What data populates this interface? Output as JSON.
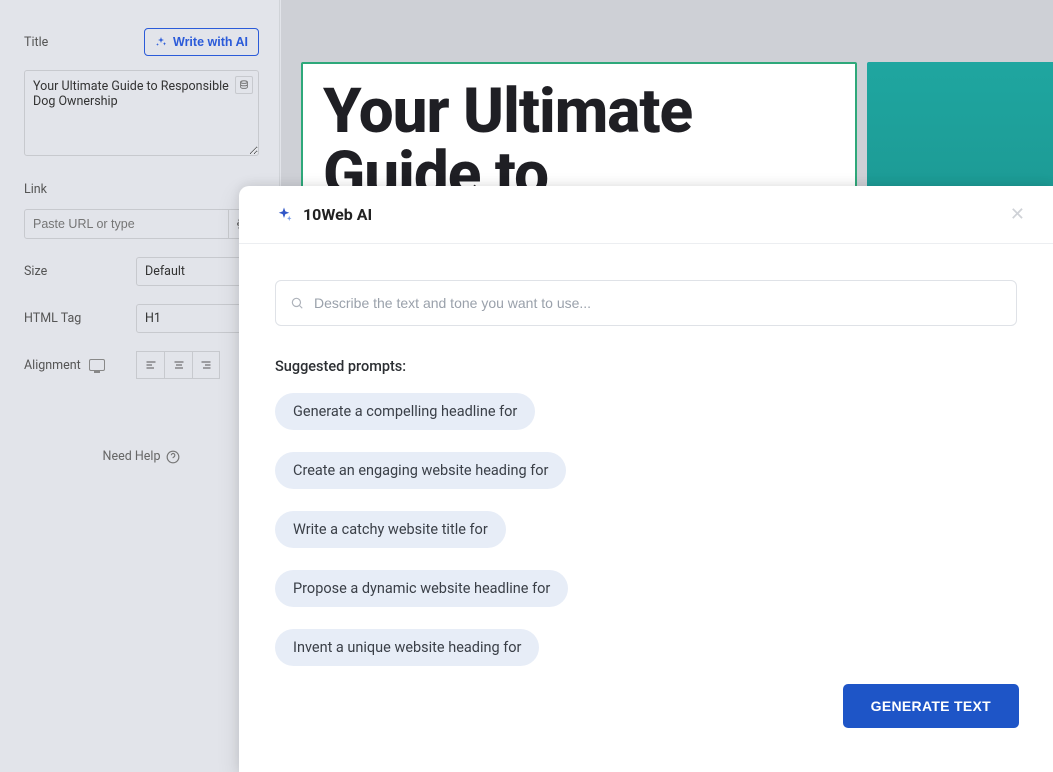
{
  "sidebar": {
    "title_label": "Title",
    "write_ai_label": "Write with AI",
    "title_value": "Your Ultimate Guide to Responsible Dog Ownership",
    "link_label": "Link",
    "link_placeholder": "Paste URL or type",
    "size_label": "Size",
    "size_value": "Default",
    "html_tag_label": "HTML Tag",
    "html_tag_value": "H1",
    "alignment_label": "Alignment",
    "need_help": "Need Help"
  },
  "canvas": {
    "headline": "Your Ultimate Guide to"
  },
  "dialog": {
    "title": "10Web AI",
    "prompt_placeholder": "Describe the text and tone you want to use...",
    "suggested_label": "Suggested prompts:",
    "prompts": [
      "Generate a compelling headline for",
      "Create an engaging website heading for",
      "Write a catchy website title for",
      "Propose a dynamic website headline for",
      "Invent a unique website heading for"
    ],
    "generate_label": "GENERATE TEXT"
  }
}
